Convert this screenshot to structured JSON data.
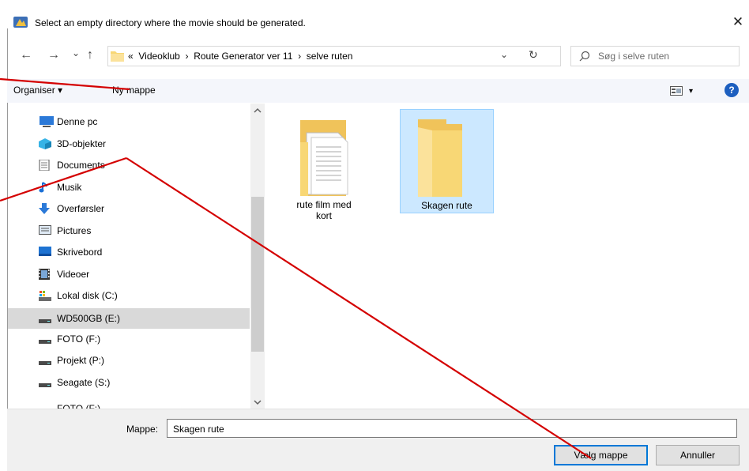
{
  "window": {
    "title": "Select an empty directory where the movie should be generated.",
    "close": "✕"
  },
  "nav_buttons": {
    "back": "←",
    "forward": "→",
    "recent": "⌄",
    "up": "↑",
    "refresh": "↻",
    "dropdown": "⌄"
  },
  "address": {
    "overflow": "«",
    "parts": [
      "Videoklub",
      "Route Generator ver 11",
      "selve ruten"
    ],
    "sep": "›"
  },
  "search": {
    "placeholder": "Søg i selve ruten"
  },
  "toolbar": {
    "organise": "Organiser ▾",
    "new_folder": "Ny mappe",
    "view_arrow": "▾",
    "help": "?"
  },
  "sidebar": {
    "items": [
      {
        "label": "Denne pc",
        "icon": "computer-icon"
      },
      {
        "label": "3D-objekter",
        "icon": "cube-icon"
      },
      {
        "label": "Documents",
        "icon": "document-icon"
      },
      {
        "label": "Musik",
        "icon": "music-icon"
      },
      {
        "label": "Overførsler",
        "icon": "download-icon"
      },
      {
        "label": "Pictures",
        "icon": "picture-icon"
      },
      {
        "label": "Skrivebord",
        "icon": "desktop-icon"
      },
      {
        "label": "Videoer",
        "icon": "video-icon"
      },
      {
        "label": "Lokal disk (C:)",
        "icon": "system-drive-icon"
      },
      {
        "label": "WD500GB (E:)",
        "icon": "drive-icon",
        "selected": true
      },
      {
        "label": "FOTO (F:)",
        "icon": "drive-icon"
      },
      {
        "label": "Projekt (P:)",
        "icon": "drive-icon"
      },
      {
        "label": "Seagate (S:)",
        "icon": "drive-icon"
      },
      {
        "label": "FOTO (F:)",
        "icon": "drive-icon"
      }
    ]
  },
  "files": [
    {
      "name_line1": "rute film med",
      "name_line2": "kort",
      "icon": "folder-with-documents-icon"
    },
    {
      "name_line1": "Skagen rute",
      "name_line2": "",
      "icon": "folder-icon",
      "selected": true
    }
  ],
  "footer": {
    "folder_label": "Mappe:",
    "folder_value": "Skagen rute",
    "select_button": "Vælg mappe",
    "cancel_button": "Annuller"
  },
  "colors": {
    "annotation_line": "#d40000",
    "selection": "#cce8ff",
    "folder": "#f8d775"
  }
}
